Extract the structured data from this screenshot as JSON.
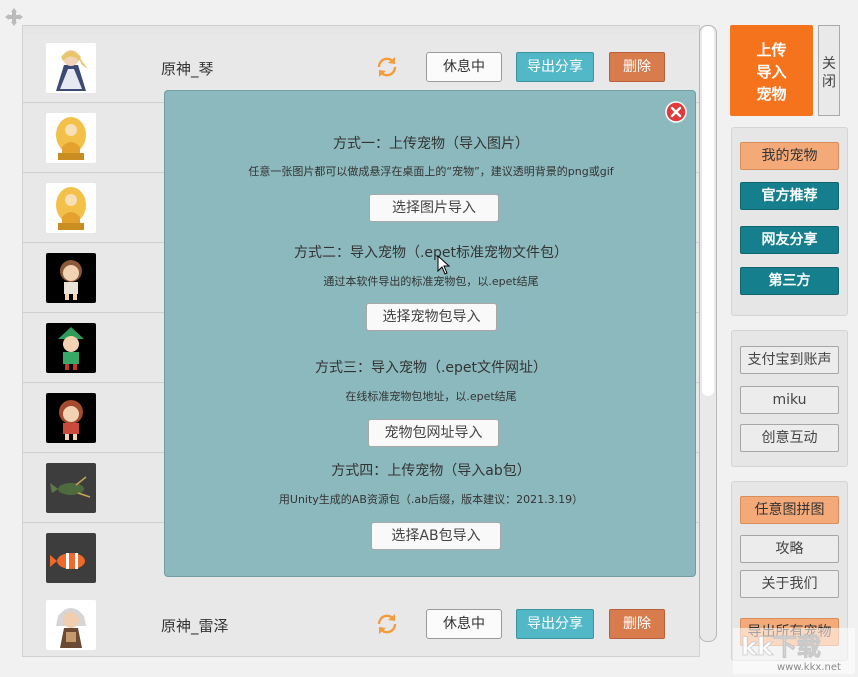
{
  "pets": [
    {
      "name": "原神_琴",
      "thumb": "character-blonde-knight",
      "status_label": "休息中",
      "export_label": "导出分享",
      "delete_label": "删除"
    },
    {
      "name": "",
      "thumb": "golden-buddha-statue"
    },
    {
      "name": "",
      "thumb": "golden-buddha-statue"
    },
    {
      "name": "",
      "thumb": "chibi-girl-brown-hair"
    },
    {
      "name": "",
      "thumb": "chibi-elf-green"
    },
    {
      "name": "",
      "thumb": "chibi-girl-red"
    },
    {
      "name": "",
      "thumb": "fish-creature"
    },
    {
      "name": "",
      "thumb": "clownfish"
    },
    {
      "name": "原神_雷泽",
      "thumb": "character-white-hair-boy",
      "status_label": "休息中",
      "export_label": "导出分享",
      "delete_label": "删除"
    }
  ],
  "dialog": {
    "method1": {
      "title": "方式一：上传宠物（导入图片）",
      "desc": "任意一张图片都可以做成悬浮在桌面上的“宠物”，建议透明背景的png或gif",
      "button": "选择图片导入"
    },
    "method2": {
      "title": "方式二：导入宠物（.epet标准宠物文件包）",
      "desc": "通过本软件导出的标准宠物包，以.epet结尾",
      "button": "选择宠物包导入"
    },
    "method3": {
      "title": "方式三：导入宠物（.epet文件网址）",
      "desc": "在线标准宠物包地址，以.epet结尾",
      "button": "宠物包网址导入"
    },
    "method4": {
      "title": "方式四：上传宠物（导入ab包）",
      "desc": "用Unity生成的AB资源包（.ab后缀，版本建议：2021.3.19）",
      "button": "选择AB包导入"
    }
  },
  "sidebar": {
    "upload_lines": [
      "上传",
      "导入",
      "宠物"
    ],
    "close_lines": [
      "关",
      "闭"
    ],
    "my_pets": "我的宠物",
    "official": "官方推荐",
    "netizen": "网友分享",
    "third_party": "第三方",
    "alipay": "支付宝到账声",
    "miku": "miku",
    "creative": "创意互动",
    "puzzle": "任意图拼图",
    "guide": "攻略",
    "about": "关于我们",
    "export_all": "导出所有宠物"
  },
  "watermark": {
    "text": "kk下载",
    "url": "www.kkx.net"
  },
  "colors": {
    "accent_orange": "#f5731d",
    "dialog_bg": "#8cb9bd",
    "teal": "#157f8d",
    "export_btn": "#52b7c7",
    "delete_btn": "#d97c4d",
    "peach": "#f4a978"
  }
}
